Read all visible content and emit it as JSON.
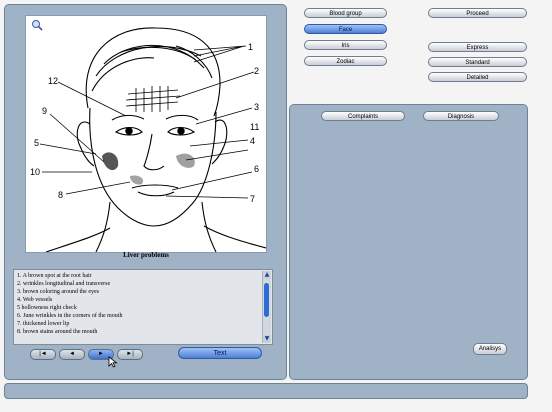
{
  "diagram": {
    "caption": "Liver problems",
    "markers": [
      "1",
      "2",
      "3",
      "4",
      "5",
      "6",
      "7",
      "8",
      "9",
      "10",
      "11",
      "12"
    ]
  },
  "symptoms": [
    "1. A brown spot at the root hair",
    "2. wrinkles longitudinal and transverse",
    "3. brown coloring around the eyes",
    "4. Web vessels",
    "5 hollowness right check",
    "6. June wrinkles in the corners of the mouth",
    "7. thickened lower lip",
    "8. brown stains around the mouth"
  ],
  "nav": {
    "first": "|◄",
    "prev": "◄",
    "next": "►",
    "last": "►|"
  },
  "text_button": "Text",
  "categories": [
    "Blood group",
    "Face",
    "Iris",
    "Zodiac"
  ],
  "actions": {
    "proceed": "Proceed",
    "express": "Express",
    "standard": "Standard",
    "detailed": "Detailed"
  },
  "tabs": {
    "complaints": "Complaints",
    "diagnosis": "Diagnosis"
  },
  "analysis_button": "Analisys"
}
